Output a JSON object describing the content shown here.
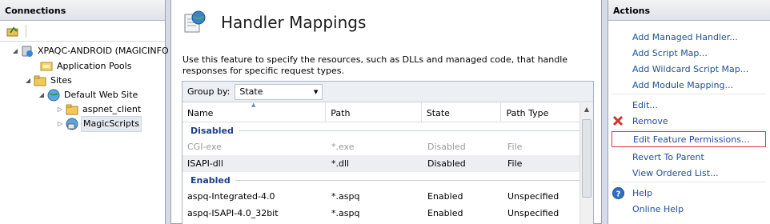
{
  "connections": {
    "header": "Connections",
    "tree": [
      {
        "label": "XPAQC-ANDROID (MAGICINFO",
        "twisty": "◢"
      },
      {
        "label": "Application Pools",
        "twisty": ""
      },
      {
        "label": "Sites",
        "twisty": "◢"
      },
      {
        "label": "Default Web Site",
        "twisty": "◢"
      },
      {
        "label": "aspnet_client",
        "twisty": "▷"
      },
      {
        "label": "MagicScripts",
        "twisty": "▷"
      }
    ]
  },
  "main": {
    "title": "Handler Mappings",
    "description": "Use this feature to specify the resources, such as DLLs and managed code, that handle responses for specific request types.",
    "group_by_label": "Group by:",
    "group_by_value": "State",
    "columns": [
      "Name",
      "Path",
      "State",
      "Path Type"
    ],
    "groups": [
      {
        "name": "Disabled",
        "rows": [
          {
            "name": "CGI-exe",
            "path": "*.exe",
            "state": "Disabled",
            "path_type": "File"
          },
          {
            "name": "ISAPI-dll",
            "path": "*.dll",
            "state": "Disabled",
            "path_type": "File"
          }
        ]
      },
      {
        "name": "Enabled",
        "rows": [
          {
            "name": "aspq-Integrated-4.0",
            "path": "*.aspq",
            "state": "Enabled",
            "path_type": "Unspecified"
          },
          {
            "name": "aspq-ISAPI-4.0_32bit",
            "path": "*.aspq",
            "state": "Enabled",
            "path_type": "Unspecified"
          }
        ]
      }
    ]
  },
  "actions": {
    "header": "Actions",
    "add_managed_handler": "Add Managed Handler...",
    "add_script_map": "Add Script Map...",
    "add_wildcard_script_map": "Add Wildcard Script Map...",
    "add_module_mapping": "Add Module Mapping...",
    "edit": "Edit...",
    "remove": "Remove",
    "edit_feature_permissions": "Edit Feature Permissions...",
    "revert_to_parent": "Revert To Parent",
    "view_ordered_list": "View Ordered List...",
    "help": "Help",
    "online_help": "Online Help"
  },
  "colors": {
    "link": "#1f4e9c",
    "group_header": "#1e3f8a",
    "highlight_border": "#d9393f"
  }
}
